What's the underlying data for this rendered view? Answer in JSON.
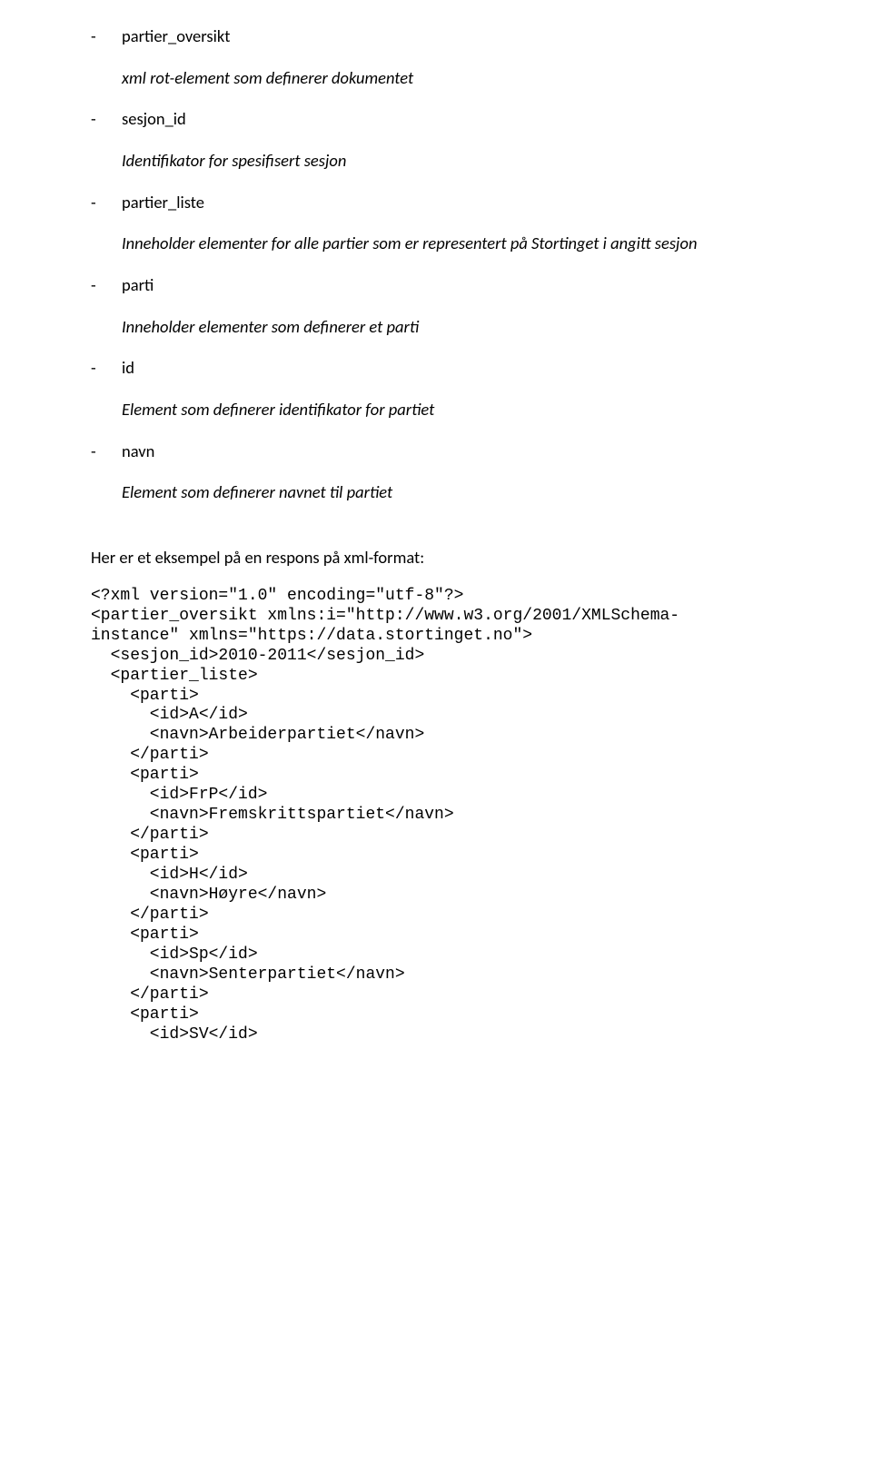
{
  "definitions": [
    {
      "term": "partier_oversikt",
      "desc": "xml rot-element som definerer dokumentet"
    },
    {
      "term": "sesjon_id",
      "desc": "Identifikator for spesifisert sesjon"
    },
    {
      "term": "partier_liste",
      "desc": "Inneholder elementer for alle partier som er representert på Stortinget i angitt sesjon"
    },
    {
      "term": "parti",
      "desc": "Inneholder elementer som definerer et parti"
    },
    {
      "term": "id",
      "desc": "Element som definerer identifikator for partiet"
    },
    {
      "term": "navn",
      "desc": "Element som definerer navnet til partiet"
    }
  ],
  "example_intro": "Her er et eksempel på en respons på xml-format:",
  "code_lines": [
    "<?xml version=\"1.0\" encoding=\"utf-8\"?>",
    "<partier_oversikt xmlns:i=\"http://www.w3.org/2001/XMLSchema-",
    "instance\" xmlns=\"https://data.stortinget.no\">",
    "  <sesjon_id>2010-2011</sesjon_id>",
    "  <partier_liste>",
    "    <parti>",
    "      <id>A</id>",
    "      <navn>Arbeiderpartiet</navn>",
    "    </parti>",
    "    <parti>",
    "      <id>FrP</id>",
    "      <navn>Fremskrittspartiet</navn>",
    "    </parti>",
    "    <parti>",
    "      <id>H</id>",
    "      <navn>Høyre</navn>",
    "    </parti>",
    "    <parti>",
    "      <id>Sp</id>",
    "      <navn>Senterpartiet</navn>",
    "    </parti>",
    "    <parti>",
    "      <id>SV</id>"
  ],
  "dash": "-"
}
